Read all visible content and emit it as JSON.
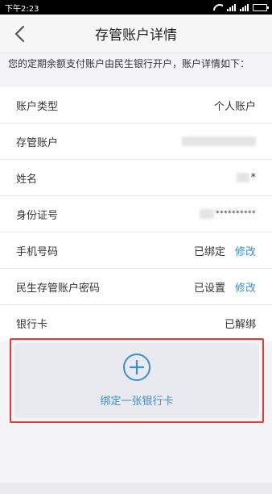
{
  "status_bar": {
    "time": "下午2:23"
  },
  "nav": {
    "title": "存管账户详情"
  },
  "notice": "您的定期余额支付账户由民生银行开户，账户详情如下：",
  "rows": [
    {
      "label": "账户类型",
      "value": "个人账户"
    },
    {
      "label": "存管账户",
      "value": ""
    },
    {
      "label": "姓名",
      "value": "*"
    },
    {
      "label": "身份证号",
      "value": "**********"
    },
    {
      "label": "手机号码",
      "value": "已绑定",
      "action": "修改"
    },
    {
      "label": "民生存管账户密码",
      "value": "已设置",
      "action": "修改"
    },
    {
      "label": "银行卡",
      "value": "已解绑"
    }
  ],
  "bind_card": {
    "label": "绑定一张银行卡"
  },
  "colors": {
    "accent": "#3a8fd0",
    "danger": "#e0302a",
    "highlight_border": "#e53935"
  },
  "icons": {
    "back": "back-arrow-icon",
    "add": "plus-circle-icon"
  }
}
